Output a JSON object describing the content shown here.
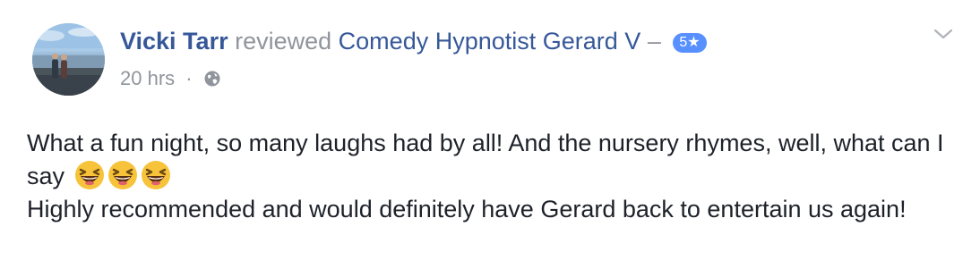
{
  "post": {
    "author_name": "Vicki Tarr",
    "action_text": "reviewed",
    "page_name": "Comedy Hypnotist Gerard V",
    "dash": "–",
    "rating_label": "5★",
    "timestamp": "20 hrs",
    "separator": "·",
    "privacy_icon": "globe-icon",
    "menu_icon": "chevron-down-icon",
    "body_line1": "What a fun night, so many laughs had by all! And the nursery rhymes, well, what can I say",
    "body_emojis": [
      "laughing-emoji",
      "laughing-emoji",
      "laughing-emoji"
    ],
    "body_line2": "Highly recommended and would definitely have Gerard back to entertain us again!"
  },
  "colors": {
    "link": "#365899",
    "muted": "#90949c",
    "text": "#1d2129",
    "badge": "#5890ff",
    "emoji_face": "#f7c33a"
  }
}
